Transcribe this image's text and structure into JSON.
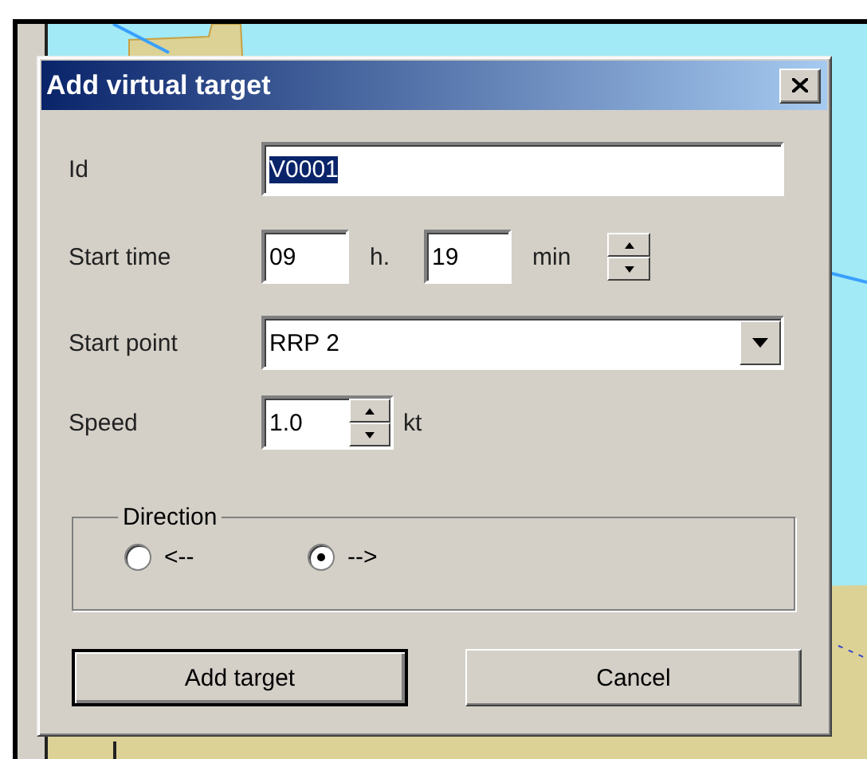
{
  "dialog": {
    "title": "Add virtual target",
    "id": {
      "label": "Id",
      "value": "V0001",
      "selected": true
    },
    "start_time": {
      "label": "Start time",
      "hours": "09",
      "hours_unit": "h.",
      "minutes": "19",
      "minutes_unit": "min"
    },
    "start_point": {
      "label": "Start point",
      "value": "RRP 2"
    },
    "speed": {
      "label": "Speed",
      "value": "1.0",
      "unit": "kt"
    },
    "direction": {
      "legend": "Direction",
      "options": [
        {
          "label": "<--",
          "selected": false
        },
        {
          "label": "-->",
          "selected": true
        }
      ]
    },
    "buttons": [
      {
        "label": "Add target",
        "default": true
      },
      {
        "label": "Cancel",
        "default": false
      }
    ]
  }
}
